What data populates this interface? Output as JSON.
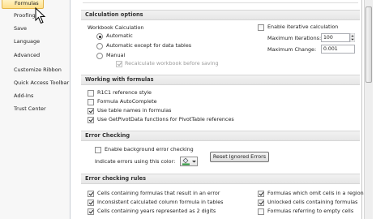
{
  "nav": {
    "items": [
      {
        "label": "Formulas",
        "selected": true
      },
      {
        "label": "Proofing"
      },
      {
        "label": "Save"
      },
      {
        "label": "Language"
      },
      {
        "label": "Advanced"
      },
      {
        "label": "Customize Ribbon"
      },
      {
        "label": "Quick Access Toolbar"
      },
      {
        "label": "Add-Ins"
      },
      {
        "label": "Trust Center"
      }
    ]
  },
  "calc_options": {
    "header": "Calculation options",
    "workbook_calc_label": "Workbook Calculation",
    "automatic": "Automatic",
    "auto_except": "Automatic except for data tables",
    "manual": "Manual",
    "recalc_before_save": "Recalculate workbook before saving",
    "iterative": "Enable iterative calculation",
    "max_iterations_label": "Maximum Iterations:",
    "max_iterations_value": "100",
    "max_change_label": "Maximum Change:",
    "max_change_value": "0.001",
    "selected_mode": "Automatic"
  },
  "working": {
    "header": "Working with formulas",
    "r1c1": "R1C1 reference style",
    "autocomplete": "Formula AutoComplete",
    "table_names": "Use table names in formulas",
    "getpivotdata": "Use GetPivotData functions for PivotTable references"
  },
  "error_checking": {
    "header": "Error Checking",
    "background": "Enable background error checking",
    "indicate_color": "Indicate errors using this color:",
    "reset_button": "Reset Ignored Errors"
  },
  "error_rules": {
    "header": "Error checking rules",
    "left": [
      {
        "label": "Cells containing formulas that result in an error",
        "checked": true
      },
      {
        "label": "Inconsistent calculated column formula in tables",
        "checked": true
      },
      {
        "label": "Cells containing years represented as 2 digits",
        "checked": true
      }
    ],
    "right": [
      {
        "label": "Formulas which omit cells in a region",
        "checked": true
      },
      {
        "label": "Unlocked cells containing formulas",
        "checked": true
      },
      {
        "label": "Formulas referring to empty cells",
        "checked": false
      }
    ]
  },
  "colors": {
    "nav_selected": "#ffe08a",
    "section_header": "#e6e6e6",
    "error_indicator": "#2e9b3f"
  }
}
